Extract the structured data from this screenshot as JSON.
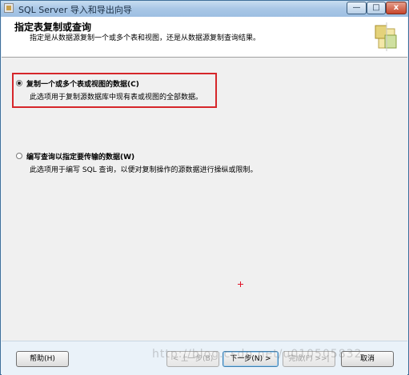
{
  "window": {
    "title": "SQL Server 导入和导出向导",
    "minimize_glyph": "—",
    "maximize_glyph": "□",
    "close_glyph": "x"
  },
  "header": {
    "title": "指定表复制或查询",
    "subtitle": "指定是从数据源复制一个或多个表和视图，还是从数据源复制查询结果。",
    "logo_icon": "wizard-logo-icon"
  },
  "options": [
    {
      "label": "复制一个或多个表或视图的数据(C)",
      "description": "此选项用于复制源数据库中现有表或视图的全部数据。",
      "selected": true
    },
    {
      "label": "编写查询以指定要传输的数据(W)",
      "description": "此选项用于编写 SQL 查询，以便对复制操作的源数据进行操纵或限制。",
      "selected": false
    }
  ],
  "buttons": {
    "help": "帮助(H)",
    "back": "< 上一步(B)",
    "next": "下一步(N) >",
    "finish": "完成(F) >>|",
    "cancel": "取消"
  },
  "watermark": "http://blog.csdn.net/u010505832",
  "colors": {
    "highlight_border": "#d6262a",
    "cursor": "#e0152a"
  }
}
